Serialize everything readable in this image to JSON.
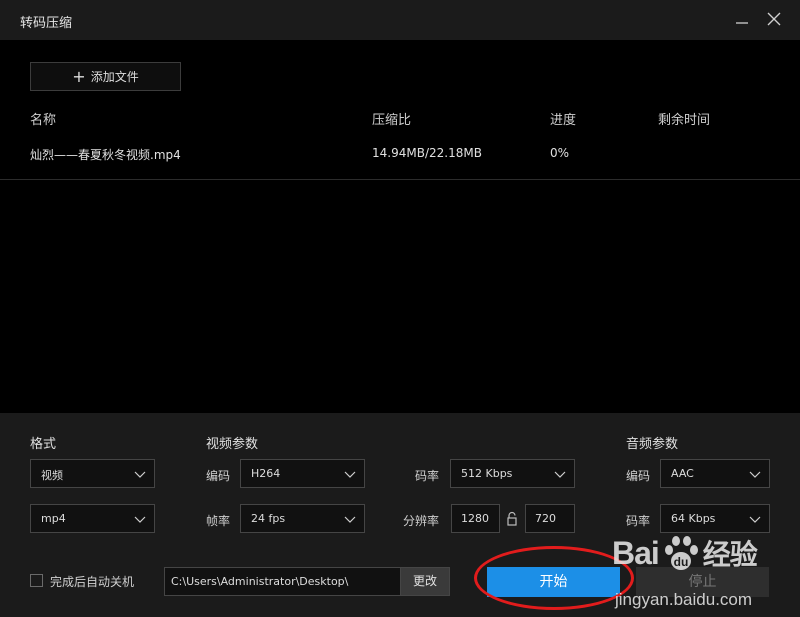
{
  "window": {
    "title": "转码压缩"
  },
  "toolbar": {
    "add_file_label": "添加文件"
  },
  "file_list": {
    "columns": [
      "名称",
      "压缩比",
      "进度",
      "剩余时间"
    ],
    "rows": [
      {
        "name": "灿烈——春夏秋冬视频.mp4",
        "ratio": "14.94MB/22.18MB",
        "progress": "0%",
        "remaining": ""
      }
    ]
  },
  "settings": {
    "format": {
      "title": "格式",
      "type_value": "视频",
      "container_value": "mp4"
    },
    "video": {
      "title": "视频参数",
      "codec_label": "编码",
      "codec_value": "H264",
      "framerate_label": "帧率",
      "framerate_value": "24 fps",
      "bitrate_label": "码率",
      "bitrate_value": "512 Kbps",
      "resolution_label": "分辨率",
      "width_value": "1280",
      "height_value": "720"
    },
    "audio": {
      "title": "音频参数",
      "codec_label": "编码",
      "codec_value": "AAC",
      "bitrate_label": "码率",
      "bitrate_value": "64 Kbps"
    }
  },
  "footer": {
    "shutdown_label": "完成后自动关机",
    "shutdown_checked": false,
    "output_path": "C:\\Users\\Administrator\\Desktop\\",
    "change_label": "更改",
    "start_label": "开始",
    "stop_label": "停止"
  },
  "watermark": {
    "logo_left": "Bai",
    "logo_right": "经验",
    "url": "jingyan.baidu.com"
  },
  "colors": {
    "accent": "#1c8fe7",
    "annotation": "#e21c1c",
    "panel_bg": "#1b1b1b",
    "list_bg": "#000000"
  }
}
